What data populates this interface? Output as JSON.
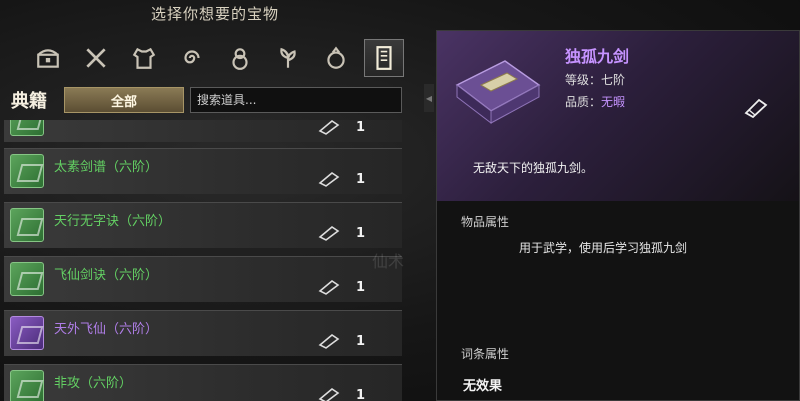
{
  "header": {
    "title": "选择你想要的宝物"
  },
  "categories": [
    {
      "icon": "chest-icon"
    },
    {
      "icon": "crossed-weapons-icon"
    },
    {
      "icon": "armor-icon"
    },
    {
      "icon": "swirl-icon"
    },
    {
      "icon": "gourd-icon"
    },
    {
      "icon": "herb-icon"
    },
    {
      "icon": "bag-icon"
    },
    {
      "icon": "book-icon",
      "active": true
    }
  ],
  "filter": {
    "category_label": "典籍",
    "selected": "全部",
    "search_placeholder": "搜索道具..."
  },
  "items": [
    {
      "name": "",
      "count": "1",
      "color": "green"
    },
    {
      "name": "太素剑谱（六阶）",
      "count": "1",
      "color": "green"
    },
    {
      "name": "天行无字诀（六阶）",
      "count": "1",
      "color": "green"
    },
    {
      "name": "飞仙剑诀（六阶）",
      "count": "1",
      "color": "green"
    },
    {
      "name": "天外飞仙（六阶）",
      "count": "1",
      "color": "purple"
    },
    {
      "name": "非攻（六阶）",
      "count": "1",
      "color": "green"
    }
  ],
  "watermark": "仙术",
  "detail": {
    "name": "独孤九剑",
    "level_label": "等级：",
    "level_value": "七阶",
    "quality_label": "品质：",
    "quality_value": "无暇",
    "description": "无敌天下的独孤九剑。",
    "attributes_title": "物品属性",
    "attributes_text": "用于武学，使用后学习独孤九剑",
    "affix_title": "词条属性",
    "affix_text": "无效果"
  },
  "colors": {
    "green_text": "#63d063",
    "purple_text": "#b07ee8",
    "detail_name": "#c693ff"
  }
}
